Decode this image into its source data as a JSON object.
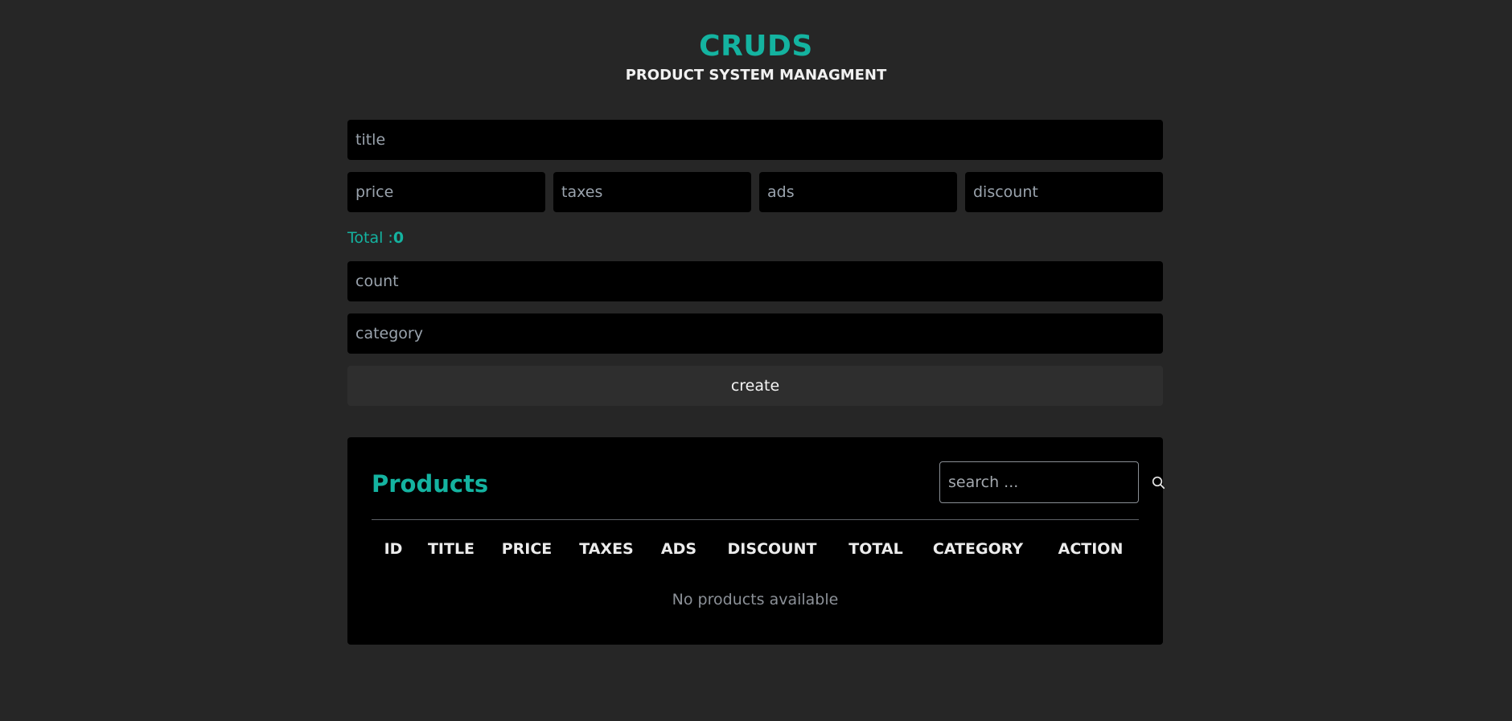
{
  "header": {
    "title": "CRUDS",
    "subtitle": "PRODUCT SYSTEM MANAGMENT"
  },
  "form": {
    "title_placeholder": "title",
    "price_placeholder": "price",
    "taxes_placeholder": "taxes",
    "ads_placeholder": "ads",
    "discount_placeholder": "discount",
    "total_label": "Total :",
    "total_value": "0",
    "count_placeholder": "count",
    "category_placeholder": "category",
    "create_label": "create"
  },
  "products": {
    "title": "Products",
    "search_placeholder": "search ...",
    "search_icon": "search-icon",
    "columns": [
      "ID",
      "TITLE",
      "PRICE",
      "TAXES",
      "ADS",
      "DISCOUNT",
      "TOTAL",
      "CATEGORY",
      "ACTION"
    ],
    "empty_message": "No products available"
  },
  "colors": {
    "accent": "#14b3a0",
    "background": "#262626",
    "panel": "#000000"
  }
}
